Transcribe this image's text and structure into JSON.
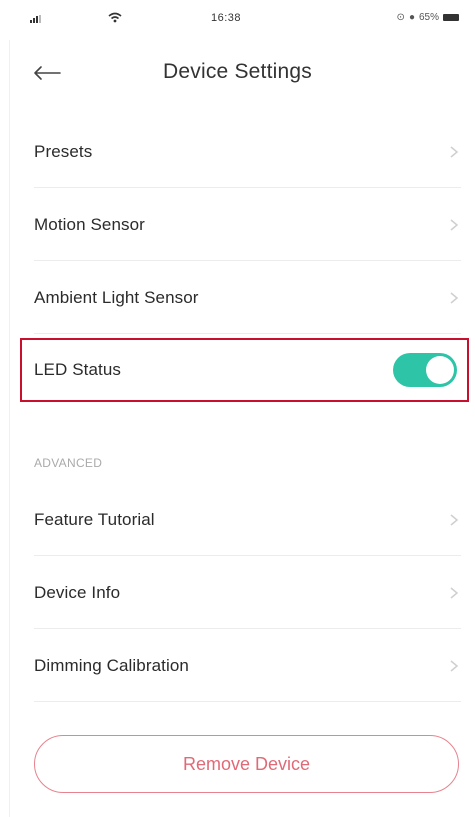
{
  "status_bar": {
    "time": "16:38",
    "battery_text": "65%"
  },
  "header": {
    "title": "Device Settings"
  },
  "rows": [
    {
      "label": "Presets"
    },
    {
      "label": "Motion Sensor"
    },
    {
      "label": "Ambient Light Sensor"
    }
  ],
  "led_status": {
    "label": "LED Status",
    "enabled": true,
    "toggle_color": "#2dc4a8",
    "highlight_color": "#c8102e"
  },
  "advanced": {
    "section_title": "ADVANCED",
    "rows": [
      {
        "label": "Feature Tutorial"
      },
      {
        "label": "Device Info"
      },
      {
        "label": "Dimming Calibration"
      }
    ]
  },
  "remove_button": {
    "label": "Remove Device",
    "color": "#e06a77"
  }
}
